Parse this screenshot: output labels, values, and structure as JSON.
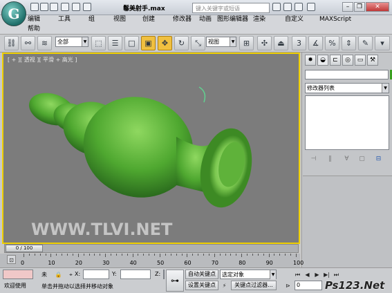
{
  "window": {
    "title": "鬈美射手.max"
  },
  "search": {
    "placeholder": "键入关键字或短语"
  },
  "menu": {
    "items": [
      "编辑(E)",
      "工具(T)",
      "组(G)",
      "视图(V)",
      "创建(C)",
      "修改器",
      "动画",
      "图形编辑器",
      "渲染(R)",
      "自定义(U)",
      "MAXScript(M)",
      "帮助(H)"
    ],
    "row1": [
      "编辑",
      "工具",
      "组",
      "视图",
      "创建",
      "修改器",
      "动画",
      "图形编辑器",
      "渲染",
      "自定义",
      "MAXScript",
      "帮助"
    ]
  },
  "toolbar": {
    "selection_filter": "全部",
    "ref_coord": "视图"
  },
  "viewport": {
    "label": "[ + ][ 透视 ][ 平滑 + 高光 ]"
  },
  "command_panel": {
    "tabs": [
      "create-icon",
      "modify-icon",
      "hierarchy-icon",
      "motion-icon",
      "display-icon",
      "utilities-icon"
    ],
    "modifier_list": "修改器列表"
  },
  "timeline": {
    "frame": "0 / 100",
    "ticks": [
      "0",
      "10",
      "20",
      "30",
      "40",
      "50",
      "60",
      "70",
      "80",
      "90",
      "100"
    ]
  },
  "status": {
    "welcome": "欢迎使用",
    "selection": "未",
    "prompt": "单击并拖动以选择并移动对象",
    "x_label": "X:",
    "y_label": "Y:",
    "z_label": "Z:",
    "autokey": "自动关键点",
    "setkey": "设置关键点",
    "select_target": "选定对象",
    "key_filters": "关键点过滤器...",
    "frame_field": "0"
  },
  "watermarks": {
    "site1": "WWW.TLVI.NET",
    "site2": "Ps123.Net"
  },
  "colors": {
    "viewport_bg": "#7c7c7c",
    "viewport_border": "#f0d000",
    "model": "#4fa830",
    "accent_active": "#f0c040"
  }
}
